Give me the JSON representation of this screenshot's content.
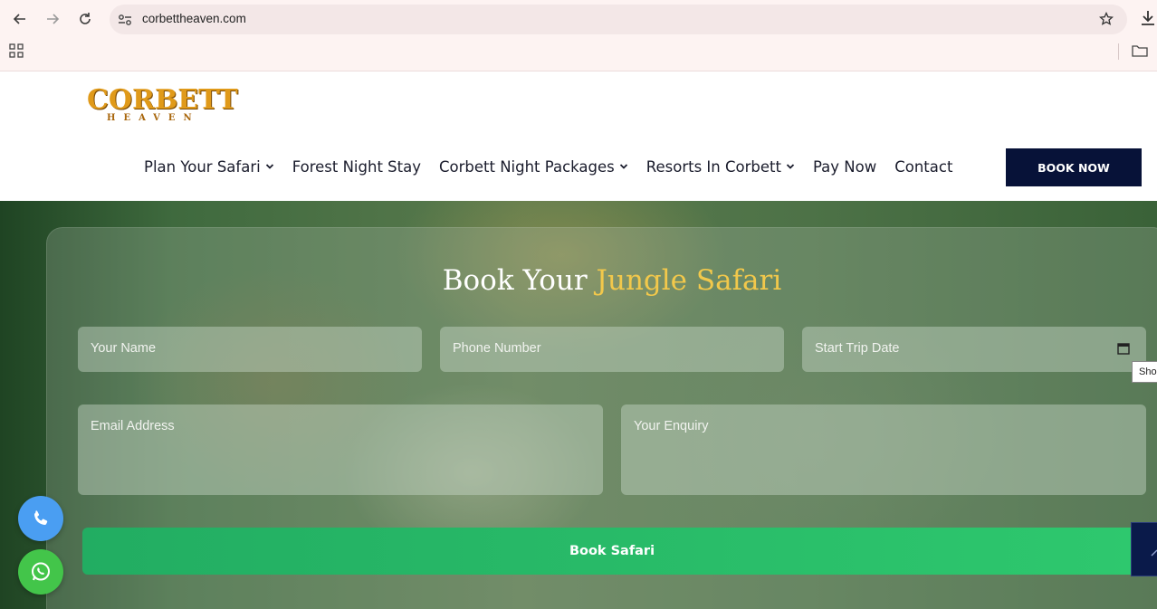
{
  "browser": {
    "url": "corbettheaven.com",
    "tooltip": "Sho"
  },
  "site": {
    "logo_word": "CORBETT",
    "logo_sub": "HEAVEN",
    "nav": [
      {
        "label": "Plan Your Safari",
        "has_dropdown": true
      },
      {
        "label": "Forest Night Stay",
        "has_dropdown": false
      },
      {
        "label": "Corbett Night Packages",
        "has_dropdown": true
      },
      {
        "label": "Resorts In Corbett",
        "has_dropdown": true
      },
      {
        "label": "Pay Now",
        "has_dropdown": false
      },
      {
        "label": "Contact",
        "has_dropdown": false
      }
    ],
    "book_now": "BOOK NOW"
  },
  "form": {
    "title_main": "Book Your ",
    "title_accent": "Jungle Safari",
    "name_placeholder": "Your Name",
    "phone_placeholder": "Phone Number",
    "date_placeholder": "Start Trip Date",
    "email_placeholder": "Email Address",
    "enquiry_placeholder": "Your Enquiry",
    "submit_label": "Book Safari"
  },
  "colors": {
    "accent_gold": "#f2c84b",
    "book_now_bg": "#071238",
    "submit_green": "#2ec86e",
    "phone_fab": "#4a9ef2",
    "whatsapp_fab": "#43c54a"
  },
  "icons": [
    "back-icon",
    "forward-icon",
    "reload-icon",
    "site-info-icon",
    "star-icon",
    "download-icon",
    "apps-icon",
    "folder-icon",
    "calendar-icon",
    "phone-icon",
    "whatsapp-icon",
    "arrow-up-icon"
  ]
}
